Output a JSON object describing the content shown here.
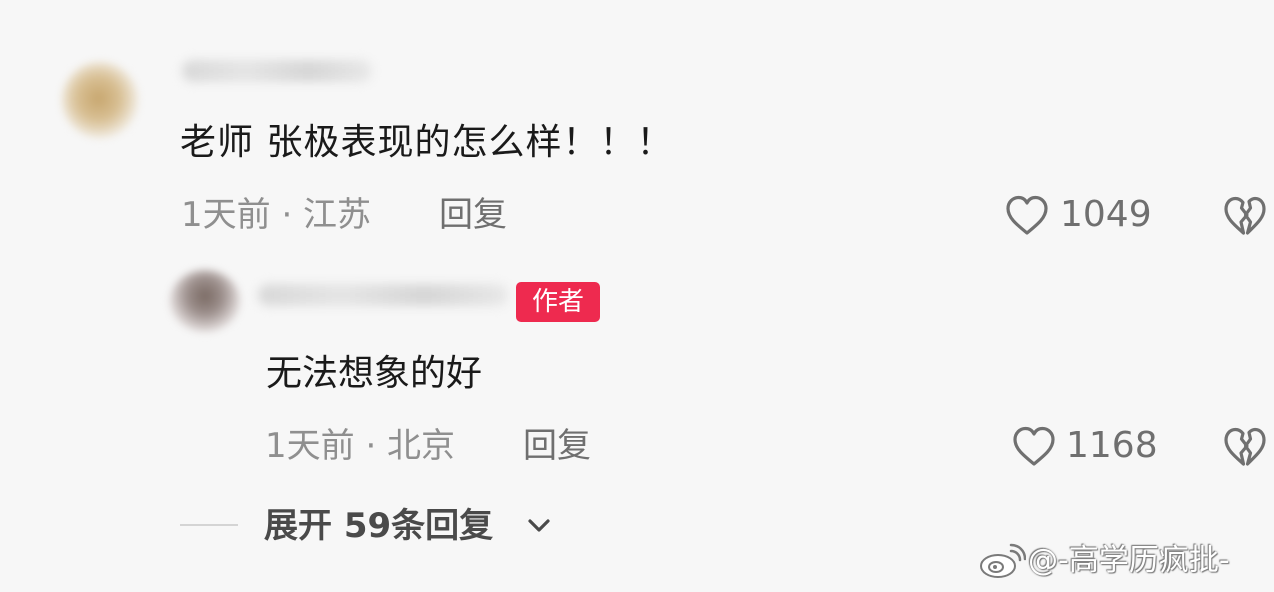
{
  "comment": {
    "text": "老师 张极表现的怎么样！！！",
    "meta": "1天前 · 江苏",
    "reply_label": "回复",
    "like_icon": "heart-outline-icon",
    "likes": "1049",
    "dislike_icon": "broken-heart-icon"
  },
  "reply": {
    "badge": "作者",
    "text": "无法想象的好",
    "meta": "1天前 · 北京",
    "reply_label": "回复",
    "like_icon": "heart-outline-icon",
    "likes": "1168",
    "dislike_icon": "broken-heart-icon"
  },
  "expand": {
    "label": "展开 59条回复",
    "icon": "chevron-down-icon"
  },
  "watermark": {
    "icon": "weibo-logo-icon",
    "text": "@-高学历疯批-"
  },
  "colors": {
    "background": "#f7f7f7",
    "badge": "#ee2a4f",
    "meta_text": "#8f8f8f"
  }
}
